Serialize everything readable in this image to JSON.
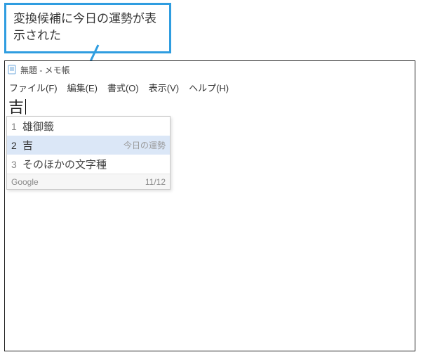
{
  "callout": {
    "text": "変換候補に今日の運勢が表示された"
  },
  "window": {
    "title": "無題 - メモ帳"
  },
  "menubar": {
    "file": "ファイル(F)",
    "edit": "編集(E)",
    "format": "書式(O)",
    "view": "表示(V)",
    "help": "ヘルプ(H)"
  },
  "editor": {
    "typed": "吉"
  },
  "ime": {
    "candidates": [
      {
        "index": "1",
        "text": "雄御籤",
        "hint": ""
      },
      {
        "index": "2",
        "text": "吉",
        "hint": "今日の運勢"
      },
      {
        "index": "3",
        "text": "そのほかの文字種",
        "hint": ""
      }
    ],
    "selected_index": 1,
    "footer_brand": "Google",
    "footer_page": "11/12"
  }
}
